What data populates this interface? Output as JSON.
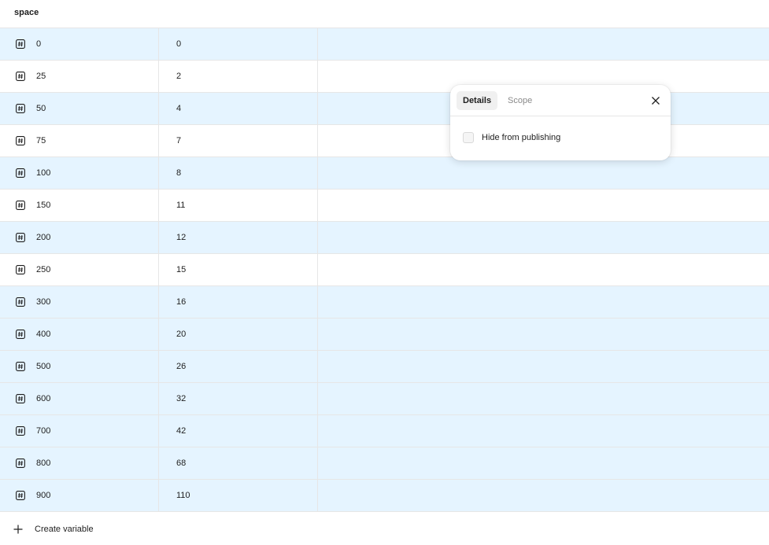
{
  "header": {
    "title": "space"
  },
  "variables": [
    {
      "name": "0",
      "value": "0",
      "selected": true
    },
    {
      "name": "25",
      "value": "2",
      "selected": false
    },
    {
      "name": "50",
      "value": "4",
      "selected": true
    },
    {
      "name": "75",
      "value": "7",
      "selected": false
    },
    {
      "name": "100",
      "value": "8",
      "selected": true
    },
    {
      "name": "150",
      "value": "11",
      "selected": false
    },
    {
      "name": "200",
      "value": "12",
      "selected": true
    },
    {
      "name": "250",
      "value": "15",
      "selected": false
    },
    {
      "name": "300",
      "value": "16",
      "selected": true
    },
    {
      "name": "400",
      "value": "20",
      "selected": true
    },
    {
      "name": "500",
      "value": "26",
      "selected": true
    },
    {
      "name": "600",
      "value": "32",
      "selected": true
    },
    {
      "name": "700",
      "value": "42",
      "selected": true
    },
    {
      "name": "800",
      "value": "68",
      "selected": true
    },
    {
      "name": "900",
      "value": "110",
      "selected": true
    }
  ],
  "footer": {
    "create_label": "Create variable",
    "icon": "plus-icon"
  },
  "popover": {
    "tabs": [
      {
        "label": "Details",
        "active": true
      },
      {
        "label": "Scope",
        "active": false
      }
    ],
    "close_icon": "close-icon",
    "checkbox": {
      "label": "Hide from publishing",
      "checked": false
    }
  },
  "colors": {
    "selected_row": "#e5f4ff",
    "border": "#e6e6e6",
    "text": "#1e1e1e",
    "muted": "#8a8a8a"
  },
  "icons": {
    "row_type": "number-variable-icon"
  }
}
